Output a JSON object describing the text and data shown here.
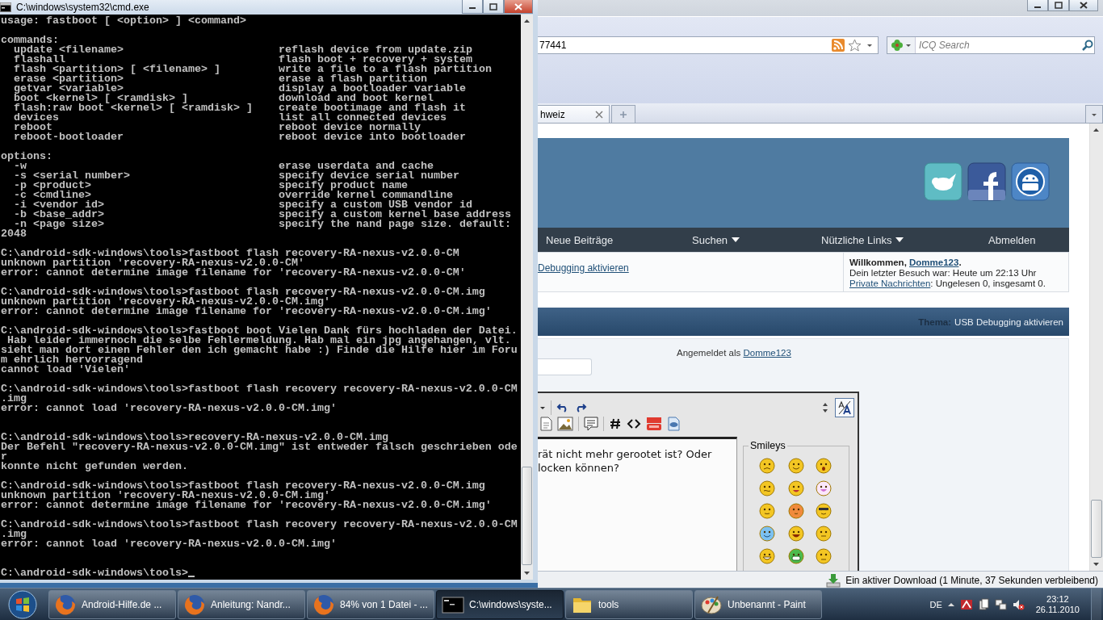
{
  "cmd_window": {
    "title": "C:\\windows\\system32\\cmd.exe",
    "cursor": true,
    "blocks": [
      {
        "kind": "paragraph",
        "lines": [
          "usage: fastboot [ <option> ] <command>"
        ]
      },
      {
        "kind": "table",
        "heading": "commands:",
        "rows": [
          {
            "arg": "update <filename>",
            "desc": "reflash device from update.zip"
          },
          {
            "arg": "flashall",
            "desc": "flash boot + recovery + system"
          },
          {
            "arg": "flash <partition> [ <filename> ]",
            "desc": "write a file to a flash partition"
          },
          {
            "arg": "erase <partition>",
            "desc": "erase a flash partition"
          },
          {
            "arg": "getvar <variable>",
            "desc": "display a bootloader variable"
          },
          {
            "arg": "boot <kernel> [ <ramdisk> ]",
            "desc": "download and boot kernel"
          },
          {
            "arg": "flash:raw boot <kernel> [ <ramdisk> ]",
            "desc": "create bootimage and flash it"
          },
          {
            "arg": "devices",
            "desc": "list all connected devices"
          },
          {
            "arg": "reboot",
            "desc": "reboot device normally"
          },
          {
            "arg": "reboot-bootloader",
            "desc": "reboot device into bootloader"
          }
        ]
      },
      {
        "kind": "table",
        "heading": "options:",
        "rows": [
          {
            "arg": "-w",
            "desc": "erase userdata and cache"
          },
          {
            "arg": "-s <serial number>",
            "desc": "specify device serial number"
          },
          {
            "arg": "-p <product>",
            "desc": "specify product name"
          },
          {
            "arg": "-c <cmdline>",
            "desc": "override kernel commandline"
          },
          {
            "arg": "-i <vendor id>",
            "desc": "specify a custom USB vendor id"
          },
          {
            "arg": "-b <base_addr>",
            "desc": "specify a custom kernel base address"
          },
          {
            "arg": "-n <page size>",
            "desc": "specify the nand page size. default:"
          }
        ],
        "continuation": "2048"
      },
      {
        "kind": "paragraph",
        "lines": [
          "C:\\android-sdk-windows\\tools>fastboot flash recovery-RA-nexus-v2.0.0-CM",
          "unknown partition 'recovery-RA-nexus-v2.0.0-CM'",
          "error: cannot determine image filename for 'recovery-RA-nexus-v2.0.0-CM'"
        ]
      },
      {
        "kind": "paragraph",
        "lines": [
          "C:\\android-sdk-windows\\tools>fastboot flash recovery-RA-nexus-v2.0.0-CM.img",
          "unknown partition 'recovery-RA-nexus-v2.0.0-CM.img'",
          "error: cannot determine image filename for 'recovery-RA-nexus-v2.0.0-CM.img'"
        ]
      },
      {
        "kind": "paragraph",
        "lines": [
          "C:\\android-sdk-windows\\tools>fastboot boot Vielen Dank fürs hochladen der Datei.",
          " Hab leider immernoch die selbe Fehlermeldung. Hab mal ein jpg angehangen, vlt.",
          "sieht man dort einen Fehler den ich gemacht habe :) Finde die Hilfe hier im Foru",
          "m ehrlich hervorragend",
          "cannot load 'Vielen'"
        ]
      },
      {
        "kind": "paragraph",
        "lines": [
          "C:\\android-sdk-windows\\tools>fastboot flash recovery recovery-RA-nexus-v2.0.0-CM",
          ".img",
          "error: cannot load 'recovery-RA-nexus-v2.0.0-CM.img'"
        ]
      },
      {
        "kind": "wide_paragraph",
        "lines": [
          "C:\\android-sdk-windows\\tools>recovery-RA-nexus-v2.0.0-CM.img",
          "Der Befehl \"recovery-RA-nexus-v2.0.0-CM.img\" ist entweder falsch geschrieben ode",
          "r",
          "konnte nicht gefunden werden."
        ]
      },
      {
        "kind": "paragraph",
        "lines": [
          "C:\\android-sdk-windows\\tools>fastboot flash recovery-RA-nexus-v2.0.0-CM.img",
          "unknown partition 'recovery-RA-nexus-v2.0.0-CM.img'",
          "error: cannot determine image filename for 'recovery-RA-nexus-v2.0.0-CM.img'"
        ]
      },
      {
        "kind": "paragraph",
        "lines": [
          "C:\\android-sdk-windows\\tools>fastboot flash recovery recovery-RA-nexus-v2.0.0-CM",
          ".img",
          "error: cannot load 'recovery-RA-nexus-v2.0.0-CM.img'"
        ]
      },
      {
        "kind": "prompt",
        "lines": [
          "C:\\android-sdk-windows\\tools>"
        ]
      }
    ]
  },
  "browser": {
    "address": "77441",
    "search_placeholder": "ICQ Search",
    "tabs": [
      {
        "label": "hweiz",
        "selected": true
      }
    ],
    "site": {
      "nav": [
        {
          "label": "Neue Beiträge",
          "dropdown": false
        },
        {
          "label": "Suchen",
          "dropdown": true
        },
        {
          "label": "Nützliche Links",
          "dropdown": true
        },
        {
          "label": "Abmelden",
          "dropdown": false
        }
      ],
      "breadcrumb_link": "Debugging aktivieren",
      "welcome": {
        "greeting": "Willkommen, ",
        "user": "Domme123",
        "end": ".",
        "last_visit": "Dein letzter Besuch war: Heute um 22:13 Uhr",
        "messages_link": "Private Nachrichten",
        "messages_text": ": Ungelesen 0, insgesamt 0."
      },
      "thread": {
        "label": "Thema:",
        "title": "USB Debugging aktivieren"
      },
      "logged_in": {
        "text": "Angemeldet als ",
        "user": "Domme123"
      },
      "editor": {
        "text_lines": [
          "rät nicht mehr gerootet ist? Oder",
          "locken können?"
        ],
        "smileys_legend": "Smileys",
        "smileys": [
          {
            "kind": "worried"
          },
          {
            "kind": "smile"
          },
          {
            "kind": "surprised"
          },
          {
            "kind": "confused"
          },
          {
            "kind": "tongue"
          },
          {
            "kind": "laugh"
          },
          {
            "kind": "neutral"
          },
          {
            "kind": "blush"
          },
          {
            "kind": "cool"
          },
          {
            "kind": "wink"
          },
          {
            "kind": "grin"
          },
          {
            "kind": "flat"
          },
          {
            "kind": "thumbs"
          },
          {
            "kind": "toothy"
          },
          {
            "kind": "roll"
          }
        ]
      }
    },
    "download_status": "Ein aktiver Download (1 Minute, 37 Sekunden verbleibend)"
  },
  "taskbar": {
    "buttons": [
      {
        "label": "Android-Hilfe.de ...",
        "kind": "firefox",
        "selected": false
      },
      {
        "label": "Anleitung: Nandr...",
        "kind": "firefox",
        "selected": false
      },
      {
        "label": "84% von 1 Datei - ...",
        "kind": "firefox",
        "selected": false
      },
      {
        "label": "C:\\windows\\syste...",
        "kind": "console",
        "selected": true
      },
      {
        "label": "tools",
        "kind": "folder",
        "selected": false
      },
      {
        "label": "Unbenannt - Paint",
        "kind": "paint",
        "selected": false
      }
    ],
    "language": "DE",
    "time": "23:12",
    "date": "26.11.2010"
  }
}
